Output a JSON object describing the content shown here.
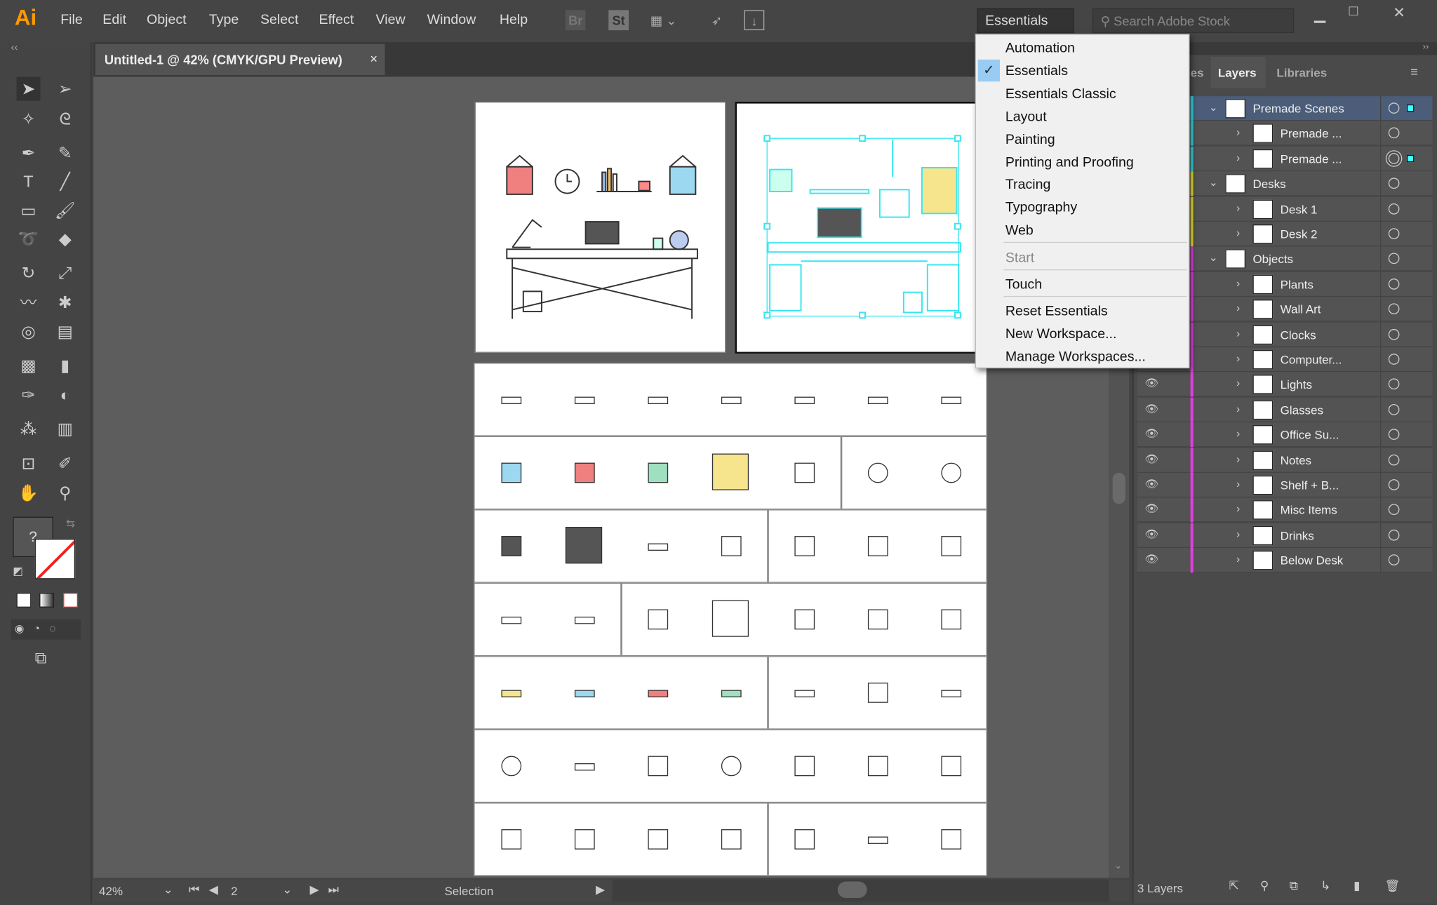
{
  "app": {
    "logo": "Ai",
    "menu": [
      "File",
      "Edit",
      "Object",
      "Type",
      "Select",
      "Effect",
      "View",
      "Window",
      "Help"
    ],
    "toolbar_icons": [
      "Br",
      "St",
      "arrange-documents-icon",
      "gpu-performance-icon",
      "publish-icon"
    ]
  },
  "workspace": {
    "current": "Essentials",
    "search_placeholder": "Search Adobe Stock",
    "menu": {
      "items": [
        "Automation",
        "Essentials",
        "Essentials Classic",
        "Layout",
        "Painting",
        "Printing and Proofing",
        "Tracing",
        "Typography",
        "Web"
      ],
      "checked": "Essentials",
      "disabled": "Start",
      "touch": "Touch",
      "actions": [
        "Reset Essentials",
        "New Workspace...",
        "Manage Workspaces..."
      ]
    }
  },
  "document": {
    "tab_title": "Untitled-1 @ 42% (CMYK/GPU Preview)",
    "close": "×"
  },
  "status": {
    "zoom": "42%",
    "artboard": "2",
    "tool": "Selection"
  },
  "panel": {
    "tabs": [
      "es",
      "Layers",
      "Libraries"
    ],
    "active_tab": "Layers",
    "footer": "3 Layers",
    "layers": [
      {
        "name": "Premade Scenes",
        "level": 0,
        "color": "#35d7e0",
        "expanded": true,
        "selected": true,
        "eye": false
      },
      {
        "name": "Premade ...",
        "level": 1,
        "color": "#35d7e0",
        "eye": false
      },
      {
        "name": "Premade ...",
        "level": 1,
        "color": "#35d7e0",
        "eye": false,
        "targeted": true
      },
      {
        "name": "Desks",
        "level": 0,
        "color": "#e8e030",
        "expanded": true,
        "eye": false
      },
      {
        "name": "Desk 1",
        "level": 1,
        "color": "#e8e030",
        "eye": false
      },
      {
        "name": "Desk 2",
        "level": 1,
        "color": "#e8e030",
        "eye": false
      },
      {
        "name": "Objects",
        "level": 0,
        "color": "#e040e0",
        "expanded": true,
        "eye": false
      },
      {
        "name": "Plants",
        "level": 1,
        "color": "#e040e0",
        "eye": false
      },
      {
        "name": "Wall Art",
        "level": 1,
        "color": "#e040e0",
        "eye": false
      },
      {
        "name": "Clocks",
        "level": 1,
        "color": "#e040e0",
        "eye": false
      },
      {
        "name": "Computer...",
        "level": 1,
        "color": "#e040e0",
        "eye": false
      },
      {
        "name": "Lights",
        "level": 1,
        "color": "#e040e0",
        "eye": true
      },
      {
        "name": "Glasses",
        "level": 1,
        "color": "#e040e0",
        "eye": true
      },
      {
        "name": "Office Su...",
        "level": 1,
        "color": "#e040e0",
        "eye": true
      },
      {
        "name": "Notes",
        "level": 1,
        "color": "#e040e0",
        "eye": true
      },
      {
        "name": "Shelf + B...",
        "level": 1,
        "color": "#e040e0",
        "eye": true
      },
      {
        "name": "Misc Items",
        "level": 1,
        "color": "#e040e0",
        "eye": true
      },
      {
        "name": "Drinks",
        "level": 1,
        "color": "#e040e0",
        "eye": true
      },
      {
        "name": "Below Desk",
        "level": 1,
        "color": "#e040e0",
        "eye": true
      }
    ]
  },
  "colors": {
    "accent_selection": "#35e6f0",
    "menu_check": "#99ccf2",
    "logo": "#ff9a00"
  },
  "objects_grid": [
    {
      "divider": null,
      "icons": [
        "plant",
        "plant",
        "plant",
        "plant",
        "plant",
        "plant",
        "plant"
      ]
    },
    {
      "divider": 5,
      "icons": [
        "frame-blue",
        "frame-red",
        "frame-green",
        "frame-yellow",
        "hanger",
        "clock",
        "clock"
      ]
    },
    {
      "divider": 4,
      "icons": [
        "laptop",
        "monitor",
        "cable",
        "speaker",
        "desk-lamp",
        "bulb",
        "pendant-lamp"
      ]
    },
    {
      "divider": 2,
      "icons": [
        "glasses",
        "glasses",
        "box",
        "calendar",
        "stapler",
        "cup",
        "tray"
      ]
    },
    {
      "divider": 4,
      "icons": [
        "note-yellow",
        "note-blue",
        "note-red",
        "note-green",
        "shelf",
        "books",
        "pen"
      ]
    },
    {
      "divider": null,
      "icons": [
        "headphones",
        "cable",
        "camera",
        "fishbowl",
        "phone",
        "printer",
        "hourglass"
      ]
    },
    {
      "divider": 4,
      "icons": [
        "glass",
        "mug",
        "coffee",
        "drink",
        "bin",
        "cable",
        "outlet"
      ]
    }
  ]
}
